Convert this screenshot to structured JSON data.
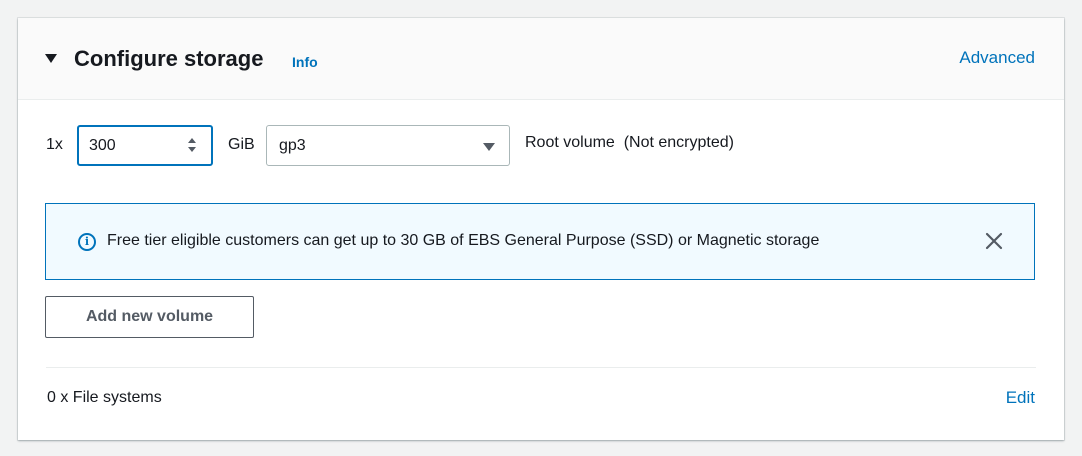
{
  "storage": {
    "title": "Configure storage",
    "info_label": "Info",
    "advanced_label": "Advanced",
    "expanded": true
  },
  "volume": {
    "multiplier": "1x",
    "size_value": "300",
    "unit": "GiB",
    "type_value": "gp3",
    "root_label": "Root volume  (Not encrypted)"
  },
  "alert": {
    "message": "Free tier eligible customers can get up to 30 GB of EBS General Purpose (SSD) or Magnetic storage",
    "icon": "info-circle-icon"
  },
  "actions": {
    "add_volume_label": "Add new volume"
  },
  "file_systems": {
    "label": "0 x File systems",
    "edit_label": "Edit"
  },
  "colors": {
    "link": "#0073bb",
    "alert_bg": "#f1faff",
    "alert_border": "#0073bb",
    "focus_border": "#0073bb"
  }
}
